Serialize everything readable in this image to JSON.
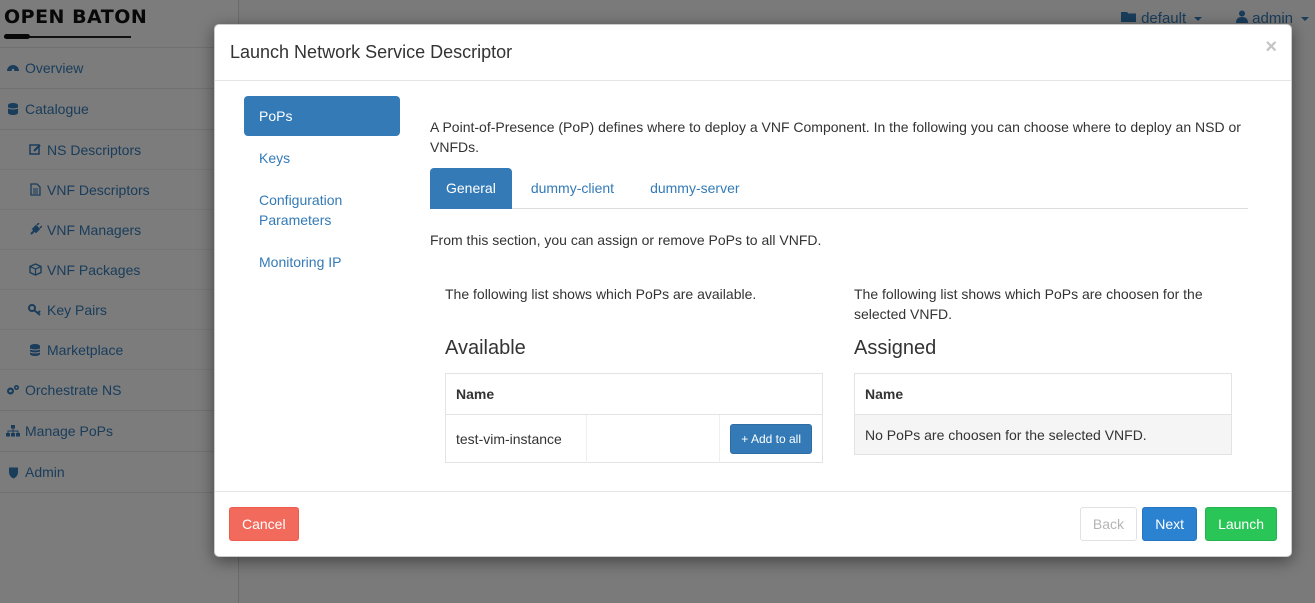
{
  "app": {
    "brand": "OPEN BATON",
    "topbar": {
      "project": "default",
      "user": "admin"
    },
    "nav": [
      {
        "label": "Overview",
        "icon": "dashboard-icon",
        "sub": false
      },
      {
        "label": "Catalogue",
        "icon": "database-icon",
        "sub": false
      },
      {
        "label": "NS Descriptors",
        "icon": "edit-icon",
        "sub": true
      },
      {
        "label": "VNF Descriptors",
        "icon": "file-icon",
        "sub": true
      },
      {
        "label": "VNF Managers",
        "icon": "plug-icon",
        "sub": true
      },
      {
        "label": "VNF Packages",
        "icon": "cube-icon",
        "sub": true
      },
      {
        "label": "Key Pairs",
        "icon": "key-icon",
        "sub": true
      },
      {
        "label": "Marketplace",
        "icon": "database-icon",
        "sub": true
      },
      {
        "label": "Orchestrate NS",
        "icon": "gears-icon",
        "sub": false
      },
      {
        "label": "Manage PoPs",
        "icon": "sitemap-icon",
        "sub": false
      },
      {
        "label": "Admin",
        "icon": "shield-icon",
        "sub": false
      }
    ]
  },
  "modal": {
    "title": "Launch Network Service Descriptor",
    "close": "×",
    "pills": [
      "PoPs",
      "Keys",
      "Configuration Parameters",
      "Monitoring IP"
    ],
    "intro": "A Point-of-Presence (PoP) defines where to deploy a VNF Component. In the following you can choose where to deploy an NSD or VNFDs.",
    "tabs": [
      "General",
      "dummy-client",
      "dummy-server"
    ],
    "section_note": "From this section, you can assign or remove PoPs to all VNFD.",
    "available": {
      "desc": "The following list shows which PoPs are available.",
      "heading": "Available",
      "column": "Name",
      "rows": [
        {
          "name": "test-vim-instance",
          "action": "+ Add to all"
        }
      ]
    },
    "assigned": {
      "desc": "The following list shows which PoPs are choosen for the selected VNFD.",
      "heading": "Assigned",
      "column": "Name",
      "empty": "No PoPs are choosen for the selected VNFD."
    },
    "footer": {
      "cancel": "Cancel",
      "back": "Back",
      "next": "Next",
      "launch": "Launch"
    }
  },
  "colors": {
    "primary": "#337ab7",
    "danger": "#f26a5b",
    "success": "#2ac557"
  }
}
